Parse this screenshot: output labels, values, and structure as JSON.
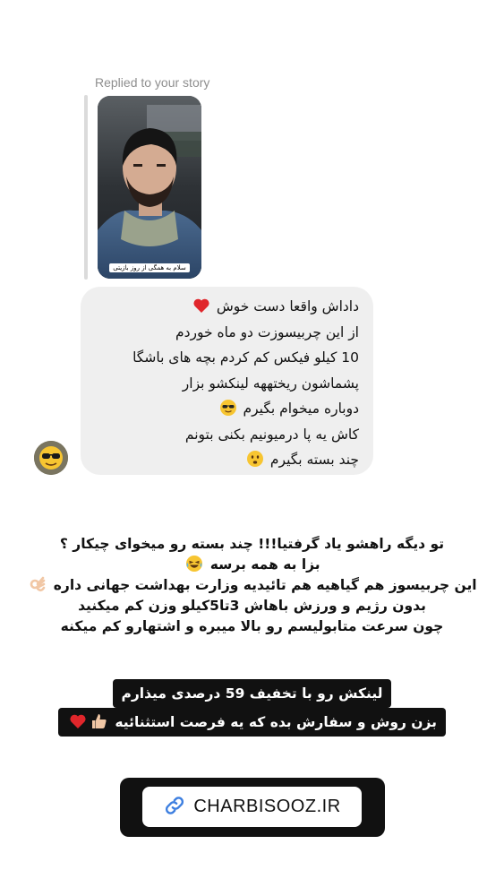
{
  "reply_header": "Replied to your story",
  "story": {
    "caption": "سلام به همگی از روز بازیتی"
  },
  "message": {
    "lines": [
      {
        "text": "داداش واقعا دست خوش",
        "emoji": "red-heart"
      },
      {
        "text": "از این چربیسوزت دو ماه خوردم",
        "emoji": ""
      },
      {
        "text": "10 کیلو فیکس کم کردم بچه های باشگا",
        "emoji": ""
      },
      {
        "text": "پشماشون ریختههه لینکشو بزار",
        "emoji": ""
      },
      {
        "text": "دوباره میخوام بگیرم",
        "emoji": "sunglasses-face"
      },
      {
        "text": "کاش یه پا درمیونیم بکنی بتونم",
        "emoji": ""
      },
      {
        "text": "چند بسته بگیرم",
        "emoji": "neutral-face"
      }
    ]
  },
  "overlay": {
    "lines": [
      {
        "text": "تو دیگه راهشو یاد گرفتیا!!! چند بسته رو میخوای چیکار ؟",
        "emoji": ""
      },
      {
        "text": "بزا به همه برسه",
        "emoji": "laughing-face"
      },
      {
        "text": "این چربیسوز هم گیاهیه هم تائیدیه وزارت بهداشت جهانی داره",
        "emoji": "ok-hand"
      },
      {
        "text": "بدون رژیم و ورزش باهاش 3تا5کیلو وزن کم میکنید",
        "emoji": ""
      },
      {
        "text": "چون سرعت متابولیسم رو بالا میبره و اشتهارو کم میکنه",
        "emoji": ""
      }
    ]
  },
  "promo": {
    "line1": "لینکش رو با تخفیف 59 درصدی میذارم",
    "line2": "بزن روش و سفارش بده که یه فرصت استثنائیه"
  },
  "link_sticker": {
    "icon": "link-icon",
    "label": "CHARBISOOZ.IR"
  }
}
